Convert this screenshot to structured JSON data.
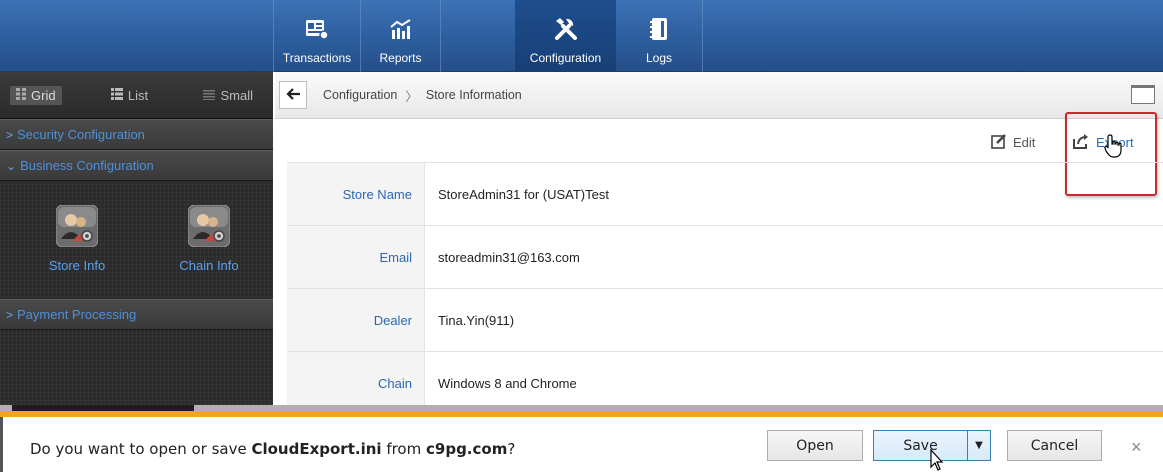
{
  "topnav": {
    "items": [
      {
        "label": "Transactions",
        "icon": "transactions-icon"
      },
      {
        "label": "Reports",
        "icon": "reports-chart-icon"
      },
      {
        "label": "Configuration",
        "icon": "tools-icon",
        "active": true
      },
      {
        "label": "Logs",
        "icon": "logbook-icon"
      }
    ]
  },
  "sidebar": {
    "views": [
      "Grid",
      "List",
      "Small"
    ],
    "selected_view": "Grid",
    "sections": [
      {
        "label": "Security Configuration",
        "expanded": false
      },
      {
        "label": "Business Configuration",
        "expanded": true
      },
      {
        "label": "Payment Processing",
        "expanded": false
      }
    ],
    "tiles": [
      "Store Info",
      "Chain Info"
    ]
  },
  "breadcrumb": {
    "items": [
      "Configuration",
      "Store Information"
    ],
    "separator": "〉"
  },
  "actions": {
    "edit_label": "Edit",
    "export_label": "Export"
  },
  "details": [
    {
      "label": "Store Name",
      "value": "StoreAdmin31 for (USAT)Test"
    },
    {
      "label": "Email",
      "value": "storeadmin31@163.com"
    },
    {
      "label": "Dealer",
      "value": "Tina.Yin(911)"
    },
    {
      "label": "Chain",
      "value": "Windows 8 and Chrome"
    }
  ],
  "download_bar": {
    "prefix": "Do you want to open or save ",
    "filename": "CloudExport.ini",
    "middle": " from ",
    "domain": "c9pg.com",
    "suffix": "?",
    "open_label": "Open",
    "save_label": "Save",
    "cancel_label": "Cancel"
  },
  "colors": {
    "nav_blue": "#2d5e9f",
    "link_blue": "#1c6fc1",
    "highlight_red": "#c9282d",
    "notification_orange": "#f3a51d"
  }
}
